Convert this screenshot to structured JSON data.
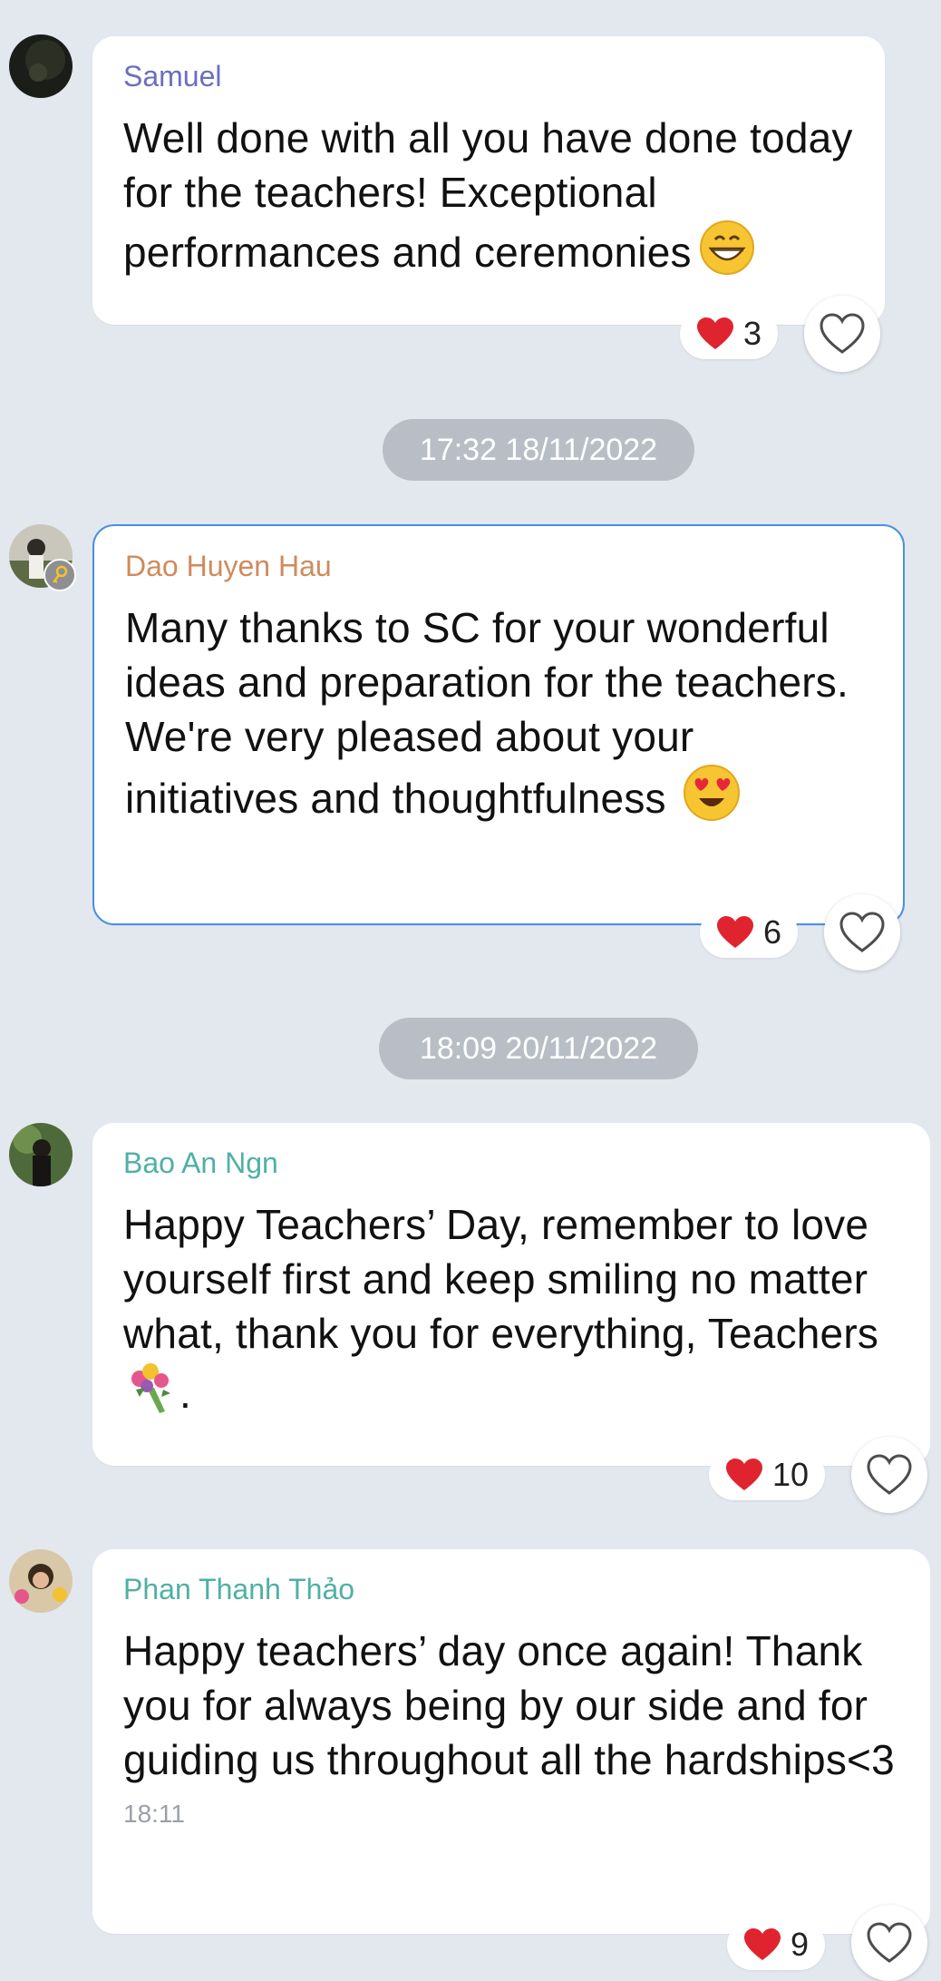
{
  "messages": [
    {
      "sender": "Samuel",
      "sender_color": "#6a6fbf",
      "text": "Well done with all you have done today for the teachers! Exceptional performances and ceremonies",
      "emoji": "grinning-face-icon",
      "reaction_count": "3"
    },
    {
      "sender": "Dao Huyen Hau",
      "sender_color": "#d08a5c",
      "text": "Many thanks to SC for your wonderful ideas and preparation for the teachers. We're very pleased about your initiatives and thoughtfulness",
      "emoji": "heart-eyes-face-icon",
      "reaction_count": "6"
    },
    {
      "sender": "Bao An Ngn",
      "sender_color": "#4fb0a5",
      "text": "Happy Teachers’ Day, remember to love yourself first and keep smiling no matter what, thank you for everything, Teachers",
      "emoji": "bouquet-icon",
      "text_suffix": ".",
      "reaction_count": "10"
    },
    {
      "sender": "Phan Thanh Thảo",
      "sender_color": "#4fb0a5",
      "text": "Happy teachers’ day once again! Thank you for always being by our side and for guiding us throughout all the hardships<3",
      "time": "18:11",
      "reaction_count": "9"
    }
  ],
  "separators": [
    {
      "label": "17:32 18/11/2022"
    },
    {
      "label": "18:09 20/11/2022"
    }
  ],
  "colors": {
    "background": "#e3e8ef",
    "selected_border": "#4a90e2",
    "heart": "#e0242f",
    "pill": "#b9bec6"
  }
}
